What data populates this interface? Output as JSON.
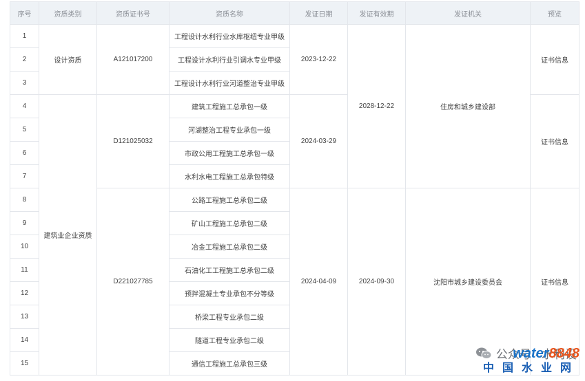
{
  "headers": [
    "序号",
    "资质类别",
    "资质证书号",
    "资质名称",
    "发证日期",
    "发证有效期",
    "发证机关",
    "预览"
  ],
  "categories": [
    "设计资质",
    "建筑业企业资质"
  ],
  "certificates": [
    "A121017200",
    "D121025032",
    "D221027785"
  ],
  "issue_dates": [
    "2023-12-22",
    "2024-03-29",
    "2024-04-09"
  ],
  "valid_until": [
    "2028-12-22",
    "2024-09-30"
  ],
  "authorities": [
    "住房和城乡建设部",
    "沈阳市城乡建设委员会"
  ],
  "preview_label": "证书信息",
  "rows": [
    {
      "no": "1",
      "name": "工程设计水利行业水库枢纽专业甲级"
    },
    {
      "no": "2",
      "name": "工程设计水利行业引调水专业甲级"
    },
    {
      "no": "3",
      "name": "工程设计水利行业河道整治专业甲级"
    },
    {
      "no": "4",
      "name": "建筑工程施工总承包一级"
    },
    {
      "no": "5",
      "name": "河湖整治工程专业承包一级"
    },
    {
      "no": "6",
      "name": "市政公用工程施工总承包一级"
    },
    {
      "no": "7",
      "name": "水利水电工程施工总承包特级"
    },
    {
      "no": "8",
      "name": "公路工程施工总承包二级"
    },
    {
      "no": "9",
      "name": "矿山工程施工总承包二级"
    },
    {
      "no": "10",
      "name": "冶金工程施工总承包二级"
    },
    {
      "no": "11",
      "name": "石油化工工程施工总承包二级"
    },
    {
      "no": "12",
      "name": "预拌混凝土专业承包不分等级"
    },
    {
      "no": "13",
      "name": "桥梁工程专业承包二级"
    },
    {
      "no": "14",
      "name": "隧道工程专业承包二级"
    },
    {
      "no": "15",
      "name": "通信工程施工总承包三级"
    }
  ],
  "watermark": {
    "text": "公众号 · 水利设",
    "brand_a": "water",
    "brand_b": "8848",
    "brand_sub": "中国水业网"
  }
}
